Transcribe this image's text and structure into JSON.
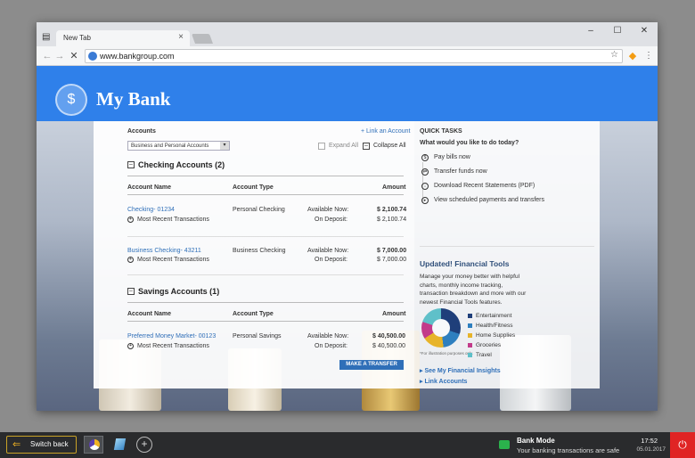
{
  "browser": {
    "tab_title": "New Tab",
    "tab_close": "×",
    "url": "www.bankgroup.com",
    "win_min": "–",
    "win_max": "☐",
    "win_close": "✕"
  },
  "bank": {
    "name": "My Bank",
    "logo_glyph": "$"
  },
  "accounts": {
    "heading": "Accounts",
    "link_account": "+ Link an Account",
    "filter_value": "Business and Personal Accounts",
    "expand_all": "Expand All",
    "collapse_all": "Collapse All",
    "checking_title": "Checking Accounts  (2)",
    "savings_title": "Savings Accounts  (1)",
    "col_name": "Account Name",
    "col_type": "Account Type",
    "col_amount": "Amount",
    "available_label": "Available Now:",
    "deposit_label": "On Deposit:",
    "recent_label": "Most Recent Transactions",
    "checking": [
      {
        "name": "Checking- 01234",
        "type": "Personal Checking",
        "available": "$ 2,100.74",
        "deposit": "$ 2,100.74"
      },
      {
        "name": "Business Checking- 43211",
        "type": "Business Checking",
        "available": "$ 7,000.00",
        "deposit": "$ 7,000.00"
      }
    ],
    "savings": [
      {
        "name": "Preferred Money Market- 00123",
        "type": "Personal Savings",
        "available": "$ 40,500.00",
        "deposit": "$ 40,500.00"
      }
    ],
    "transfer_button": "MAKE A TRANSFER"
  },
  "quick_tasks": {
    "title": "QUICK TASKS",
    "question": "What would you like to do today?",
    "tasks": [
      {
        "label": "Pay bills now",
        "icon": "$"
      },
      {
        "label": "Transfer funds now",
        "icon": "⇄"
      },
      {
        "label": "Download Recent Statements (PDF)",
        "icon": "↓"
      },
      {
        "label": "View scheduled payments and transfers",
        "icon": "▸"
      }
    ]
  },
  "tools": {
    "title": "Updated! Financial Tools",
    "description": "Manage your money better with helpful charts, monthly income tracking, transaction breakdown and more with our newest Financial Tools features.",
    "caption": "*For illustration purposes only.",
    "legend": [
      {
        "label": "Entertainment",
        "color": "#1f3f7a"
      },
      {
        "label": "Health/Fitness",
        "color": "#2e7fbf"
      },
      {
        "label": "Home Supplies",
        "color": "#e7b42a"
      },
      {
        "label": "Groceries",
        "color": "#c23b8a"
      },
      {
        "label": "Travel",
        "color": "#5fc0c9"
      }
    ],
    "insights_link": "▸ See My Financial Insights",
    "link_accounts": "▸ Link Accounts"
  },
  "taskbar": {
    "switch_back": "Switch back",
    "bank_mode": "Bank Mode",
    "bank_mode_sub": "Your banking transactions are safe",
    "time": "17:52",
    "date": "05.01.2017"
  }
}
